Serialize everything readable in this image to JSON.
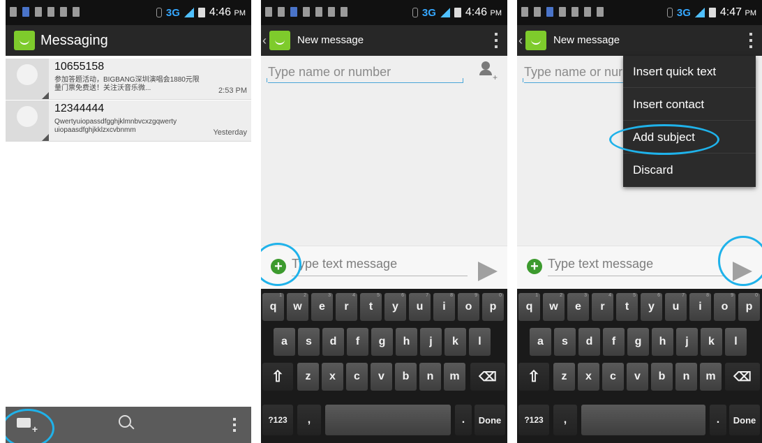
{
  "colors": {
    "accent": "#1fb2ea",
    "actionbar": "#272727",
    "statusbar": "#111111",
    "network": "#35a7ff",
    "attach_green": "#3c9a2e",
    "app_icon_green": "#7ecb2c"
  },
  "status_bar": {
    "network": "3G",
    "times": [
      "4:46",
      "4:46",
      "4:47"
    ],
    "ampm": "PM"
  },
  "screen1": {
    "title": "Messaging",
    "conversations": [
      {
        "name": "10655158",
        "snippet": "参加答题活动，BIGBANG深圳演唱会1880元限量门票免费送！关注沃音乐微...",
        "time": "2:53 PM"
      },
      {
        "name": "12344444",
        "snippet": "Qwertyuiopassdfgghjklmnbvcxzgqwerty uiopaasdfghjkklzxcvbnmm",
        "time": "Yesterday"
      }
    ],
    "bottom_icons": [
      "compose-new-icon",
      "search-icon",
      "overflow-menu-icon"
    ]
  },
  "screen2": {
    "title": "New message",
    "to_placeholder": "Type name or number",
    "message_placeholder": "Type text message"
  },
  "screen3": {
    "title": "New message",
    "to_placeholder": "Type name or nur",
    "message_placeholder": "Type text message",
    "menu": [
      "Insert quick text",
      "Insert contact",
      "Add subject",
      "Discard"
    ]
  },
  "keyboard": {
    "row1": [
      "q",
      "w",
      "e",
      "r",
      "t",
      "y",
      "u",
      "i",
      "o",
      "p"
    ],
    "row1_hints": [
      "1",
      "2",
      "3",
      "4",
      "5",
      "6",
      "7",
      "8",
      "9",
      "0"
    ],
    "row2": [
      "a",
      "s",
      "d",
      "f",
      "g",
      "h",
      "j",
      "k",
      "l"
    ],
    "row3": [
      "z",
      "x",
      "c",
      "v",
      "b",
      "n",
      "m"
    ],
    "shift": "⇧",
    "delete": "⌫",
    "symbols": "?123",
    "comma": ",",
    "period": ".",
    "done": "Done"
  }
}
